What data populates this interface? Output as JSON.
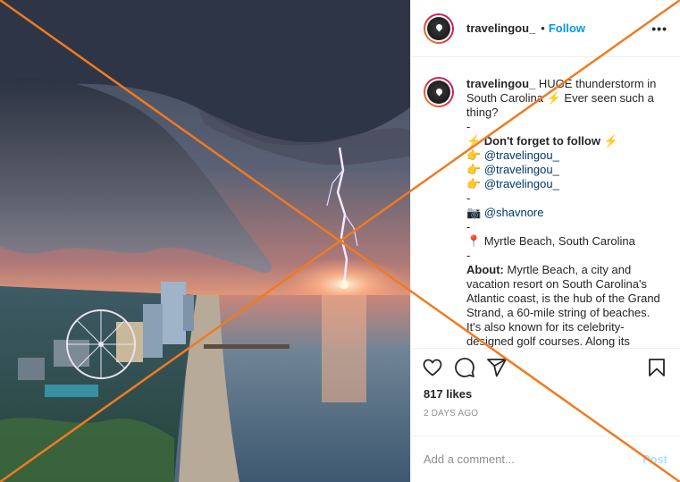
{
  "header": {
    "username": "travelingou_",
    "separator": "•",
    "follow_label": "Follow",
    "more_label": "•••"
  },
  "caption": {
    "username": "travelingou_",
    "text1": " HUGE thunderstorm in South Carolina ⚡ Ever seen such a thing?",
    "dash1": "-",
    "follow_note": "⚡ Don't forget to follow ⚡",
    "mention1_prefix": "👉 ",
    "mention1": "@travelingou_",
    "mention2_prefix": "👉 ",
    "mention2": "@travelingou_",
    "mention3_prefix": "👉 ",
    "mention3": "@travelingou_",
    "dash2": "-",
    "photo_prefix": "📷 ",
    "photo_credit": "@shavnore",
    "dash3": "-",
    "location_prefix": "📍 ",
    "location": "Myrtle Beach, South Carolina",
    "dash4": "-",
    "about_label": "About:",
    "about_text": " Myrtle Beach, a city and vacation resort on South Carolina's Atlantic coast, is the hub of the Grand Strand, a 60-mile string of beaches. It's also known for its celebrity-designed golf courses. Along its beachfront boardwalk are arcades"
  },
  "actions": {
    "like_icon": "heart-icon",
    "comment_icon": "comment-icon",
    "share_icon": "share-icon",
    "save_icon": "bookmark-icon"
  },
  "likes": "817 likes",
  "time_ago": "2 DAYS AGO",
  "comment": {
    "placeholder": "Add a comment...",
    "post_label": "Post"
  },
  "colors": {
    "accent": "#0095f6",
    "overlay_cross": "#f07a20"
  }
}
